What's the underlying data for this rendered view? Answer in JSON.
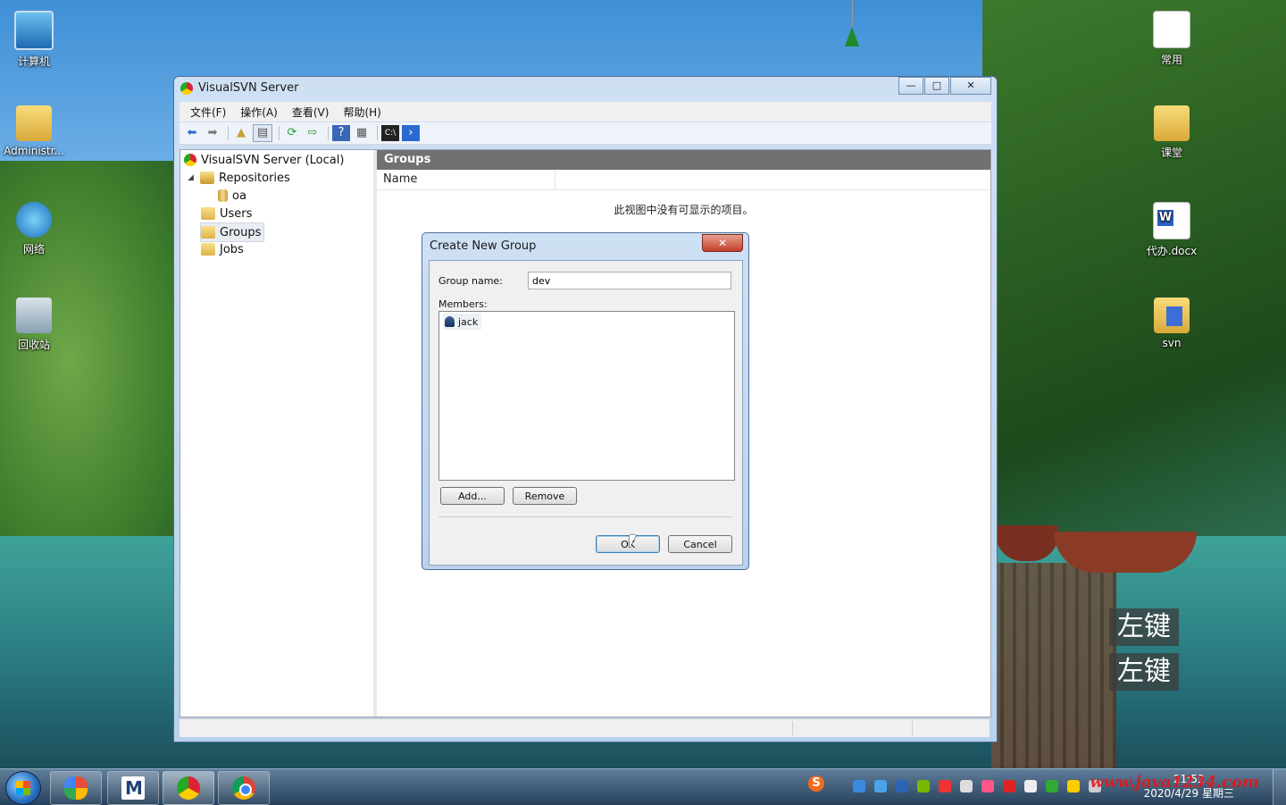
{
  "desktop": {
    "icons_left": [
      {
        "label": "计算机",
        "icon": "computer-icon"
      },
      {
        "label": "Administr...",
        "icon": "user-folder-icon"
      },
      {
        "label": "网络",
        "icon": "network-icon"
      },
      {
        "label": "回收站",
        "icon": "recycle-bin-icon"
      }
    ],
    "icons_right": [
      {
        "label": "常用",
        "icon": "document-shortcut-icon"
      },
      {
        "label": "课堂",
        "icon": "folder-shortcut-icon"
      },
      {
        "label": "代办.docx",
        "icon": "word-doc-icon"
      },
      {
        "label": "svn",
        "icon": "svn-shortcut-icon"
      }
    ],
    "key_tips": [
      "左键",
      "左键"
    ],
    "watermark": "www.java1234.com"
  },
  "window": {
    "title": "VisualSVN Server",
    "controls": {
      "minimize": "—",
      "maximize": "□",
      "close": "✕"
    },
    "menu": [
      "文件(F)",
      "操作(A)",
      "查看(V)",
      "帮助(H)"
    ],
    "toolbar": [
      "back-icon",
      "forward-icon",
      "up-folder-icon",
      "show-hide-tree-icon",
      "refresh-icon",
      "export-icon",
      "help-icon",
      "properties-icon",
      "console-icon",
      "powershell-icon"
    ]
  },
  "tree": {
    "root": "VisualSVN Server (Local)",
    "repositories": "Repositories",
    "repo_items": [
      "oa"
    ],
    "users": "Users",
    "groups": "Groups",
    "jobs": "Jobs"
  },
  "right_pane": {
    "header": "Groups",
    "column_name": "Name",
    "empty_message": "此视图中没有可显示的项目。"
  },
  "dialog": {
    "title": "Create New Group",
    "close": "✕",
    "group_name_label": "Group name:",
    "group_name_value": "dev",
    "members_label": "Members:",
    "members": [
      "jack"
    ],
    "add_label": "Add...",
    "remove_label": "Remove",
    "ok_label": "OK",
    "cancel_label": "Cancel"
  },
  "taskbar": {
    "clock_time": "21:52",
    "clock_date": "2020/4/29 星期三"
  }
}
